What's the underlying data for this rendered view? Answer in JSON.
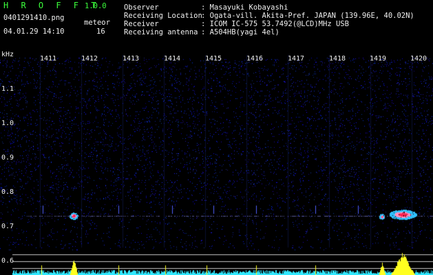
{
  "header": {
    "app_title": "H R O F F T",
    "version": "1.0.0",
    "filename": "0401291410.png",
    "datetime": "04.01.29 14:10",
    "meteor_label": "meteor",
    "meteor_count": "16",
    "info_labels": [
      "Observer",
      "Receiving Location",
      "Receiver",
      "Receiving antenna"
    ],
    "info_values": [
      ": Masayuki Kobayashi",
      ": Ogata-vill. Akita-Pref. JAPAN (139.96E, 40.02N)",
      ": ICOM IC-575 53.7492(@LCD)MHz USB",
      ": A504HB(yagi 4el)"
    ]
  },
  "axes": {
    "unit_label": "kHz",
    "minute_labels": [
      "1411",
      "1412",
      "1413",
      "1414",
      "1415",
      "1416",
      "1417",
      "1418",
      "1419",
      "1420"
    ],
    "freq_labels": [
      "1.1",
      "1.0",
      "0.9",
      "0.8",
      "0.7",
      "0.6"
    ]
  },
  "colors": {
    "background": "#000000",
    "header_green": "#3cff3c",
    "text_white": "#f0f0f0",
    "noise_blue": "#2a3cff",
    "echo_red": "#ff2050",
    "echo_pink": "#ff90c0",
    "profile_yellow": "#ffff20",
    "profile_cyan": "#30e8ff"
  }
}
